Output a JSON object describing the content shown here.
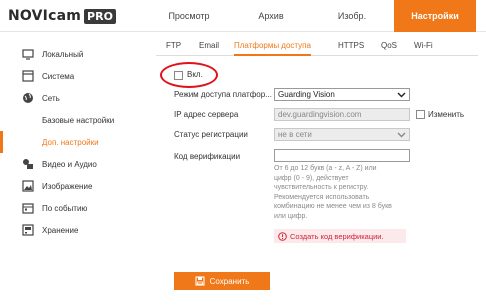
{
  "header": {
    "logo_text": "NOVIcam",
    "logo_badge": "PRO",
    "nav": [
      {
        "label": "Просмотр"
      },
      {
        "label": "Архив"
      },
      {
        "label": "Изобр."
      },
      {
        "label": "Настройки",
        "active": true
      }
    ]
  },
  "sidebar": {
    "items": [
      {
        "label": "Локальный",
        "icon": "monitor-icon"
      },
      {
        "label": "Система",
        "icon": "system-icon"
      },
      {
        "label": "Сеть",
        "icon": "globe-icon"
      },
      {
        "label": "Базовые настройки"
      },
      {
        "label": "Доп. настройки",
        "active": true
      },
      {
        "label": "Видео и Аудио",
        "icon": "video-audio-icon"
      },
      {
        "label": "Изображение",
        "icon": "image-icon"
      },
      {
        "label": "По событию",
        "icon": "event-icon"
      },
      {
        "label": "Хранение",
        "icon": "storage-icon"
      }
    ]
  },
  "tabs": [
    {
      "label": "FTP"
    },
    {
      "label": "Email"
    },
    {
      "label": "Платформы доступа",
      "active": true
    },
    {
      "label": "HTTPS"
    },
    {
      "label": "QoS"
    },
    {
      "label": "Wi-Fi"
    }
  ],
  "form": {
    "enable_label": "Вкл.",
    "enable_checked": false,
    "access_mode_label": "Режим доступа платфор...",
    "access_mode_value": "Guarding Vision",
    "server_ip_label": "IP адрес сервера",
    "server_ip_value": "dev.guardingvision.com",
    "edit_label": "Изменить",
    "reg_status_label": "Статус регистрации",
    "reg_status_value": "не в сети",
    "verify_code_label": "Код верификации",
    "verify_code_value": "",
    "hint": "От 6 до 12 букв (a - z, A - Z) или цифр (0 - 9), действует чувствительность к регистру. Рекомендуется использовать комбинацию не менее чем из 8 букв или цифр.",
    "warning": "Создать код верификации."
  },
  "save_button": "Сохранить",
  "colors": {
    "accent": "#f07818",
    "highlight_circle": "#e0121b",
    "warning_text": "#d2243a"
  }
}
